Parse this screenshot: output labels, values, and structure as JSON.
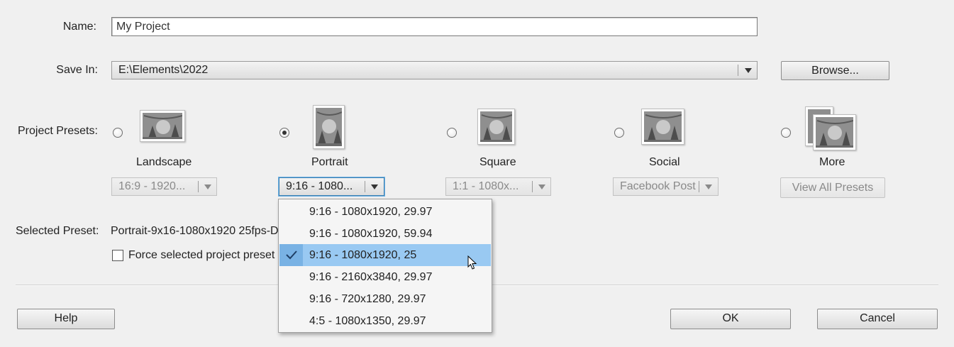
{
  "form": {
    "name_label": "Name:",
    "name_value": "My Project",
    "savein_label": "Save In:",
    "savein_value": "E:\\Elements\\2022",
    "browse_label": "Browse...",
    "presets_label": "Project Presets:",
    "selected_preset_label": "Selected Preset:",
    "selected_preset_value": "Portrait-9x16-1080x1920 25fps-D",
    "force_label": "Force selected project preset",
    "force_checked": false
  },
  "presets": [
    {
      "name": "Landscape",
      "combo": "16:9 - 1920...",
      "selected": false,
      "enabled": false
    },
    {
      "name": "Portrait",
      "combo": "9:16 - 1080...",
      "selected": true,
      "enabled": true
    },
    {
      "name": "Square",
      "combo": "1:1 - 1080x...",
      "selected": false,
      "enabled": false
    },
    {
      "name": "Social",
      "combo": "Facebook Post",
      "selected": false,
      "enabled": false
    },
    {
      "name": "More",
      "button": "View All Presets",
      "selected": false,
      "enabled": false
    }
  ],
  "dropdown": {
    "items": [
      "9:16 - 1080x1920, 29.97",
      "9:16 - 1080x1920, 59.94",
      "9:16 - 1080x1920, 25",
      "9:16 - 2160x3840, 29.97",
      "9:16 - 720x1280, 29.97",
      "4:5 - 1080x1350, 29.97"
    ],
    "selected_item": "9:16 - 1080x1920, 25"
  },
  "buttons": {
    "help": "Help",
    "ok": "OK",
    "cancel": "Cancel"
  },
  "colors": {
    "highlight": "#99c9f2",
    "focus": "#3c7fb1"
  }
}
